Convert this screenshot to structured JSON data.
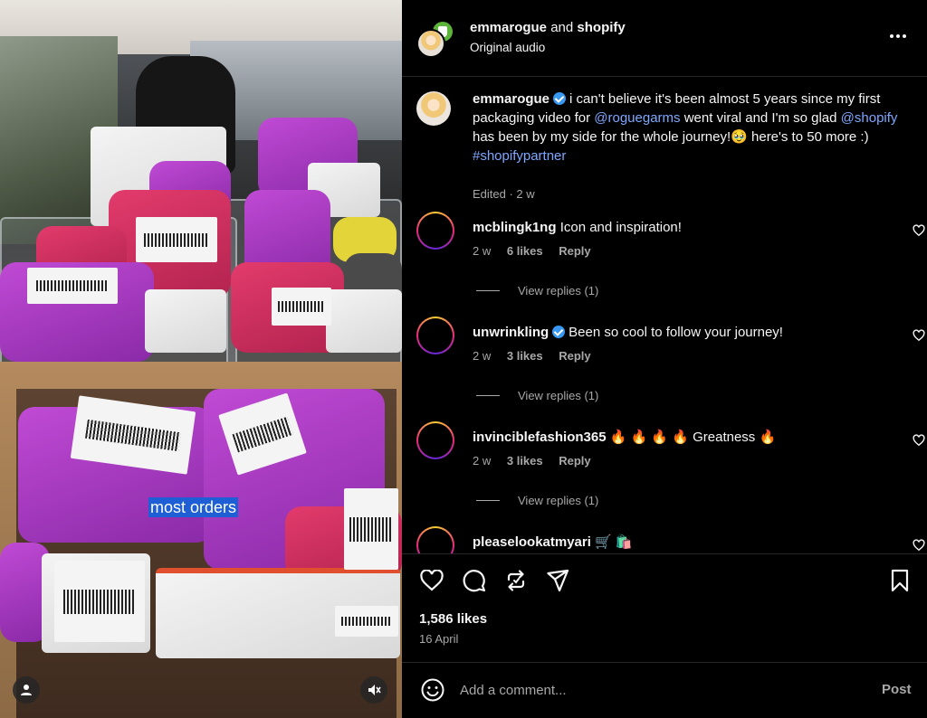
{
  "media": {
    "caption_text": "most orders",
    "user_icon": "user-icon",
    "mute_icon": "speaker-muted-icon"
  },
  "header": {
    "user1": "emmarogue",
    "joiner": "and",
    "user2": "shopify",
    "audio": "Original audio",
    "more_icon": "more-horizontal-icon"
  },
  "post_caption": {
    "username": "emmarogue",
    "text_1": "i can't believe it's been almost 5 years since my first packaging video for ",
    "mention_1": "@roguegarms",
    "text_2": " went viral and I'm so glad ",
    "mention_2": "@shopify",
    "text_3": " has been by my side for the whole journey!🥹 here's to 50 more :) ",
    "hashtag": "#shopifypartner",
    "meta": "Edited · 2 w"
  },
  "comments": [
    {
      "username": "mcblingk1ng",
      "verified": false,
      "text": "Icon and inspiration!",
      "time": "2 w",
      "likes": "6 likes",
      "reply": "Reply",
      "view_replies": "View replies (1)"
    },
    {
      "username": "unwrinkling",
      "verified": true,
      "text": "Been so cool to follow your journey!",
      "time": "2 w",
      "likes": "3 likes",
      "reply": "Reply",
      "view_replies": "View replies (1)"
    },
    {
      "username": "invinciblefashion365",
      "verified": false,
      "text": "🔥 🔥 🔥 🔥  Greatness 🔥",
      "time": "2 w",
      "likes": "3 likes",
      "reply": "Reply",
      "view_replies": "View replies (1)"
    },
    {
      "username": "pleaselookatmyari",
      "verified": false,
      "text": "🛒 🛍️",
      "time": "",
      "likes": "",
      "reply": "",
      "view_replies": ""
    }
  ],
  "actions": {
    "like_icon": "heart-icon",
    "comment_icon": "comment-icon",
    "repost_icon": "repost-icon",
    "share_icon": "send-icon",
    "save_icon": "bookmark-icon"
  },
  "stats": {
    "likes": "1,586 likes",
    "date": "16 April"
  },
  "comment_box": {
    "placeholder": "Add a comment...",
    "post_label": "Post",
    "emoji_icon": "emoji-icon"
  },
  "colors": {
    "background": "#000000",
    "text": "#f5f5f5",
    "muted": "#a8a8a8",
    "link": "#7ea8ff",
    "verified": "#3897f0"
  }
}
